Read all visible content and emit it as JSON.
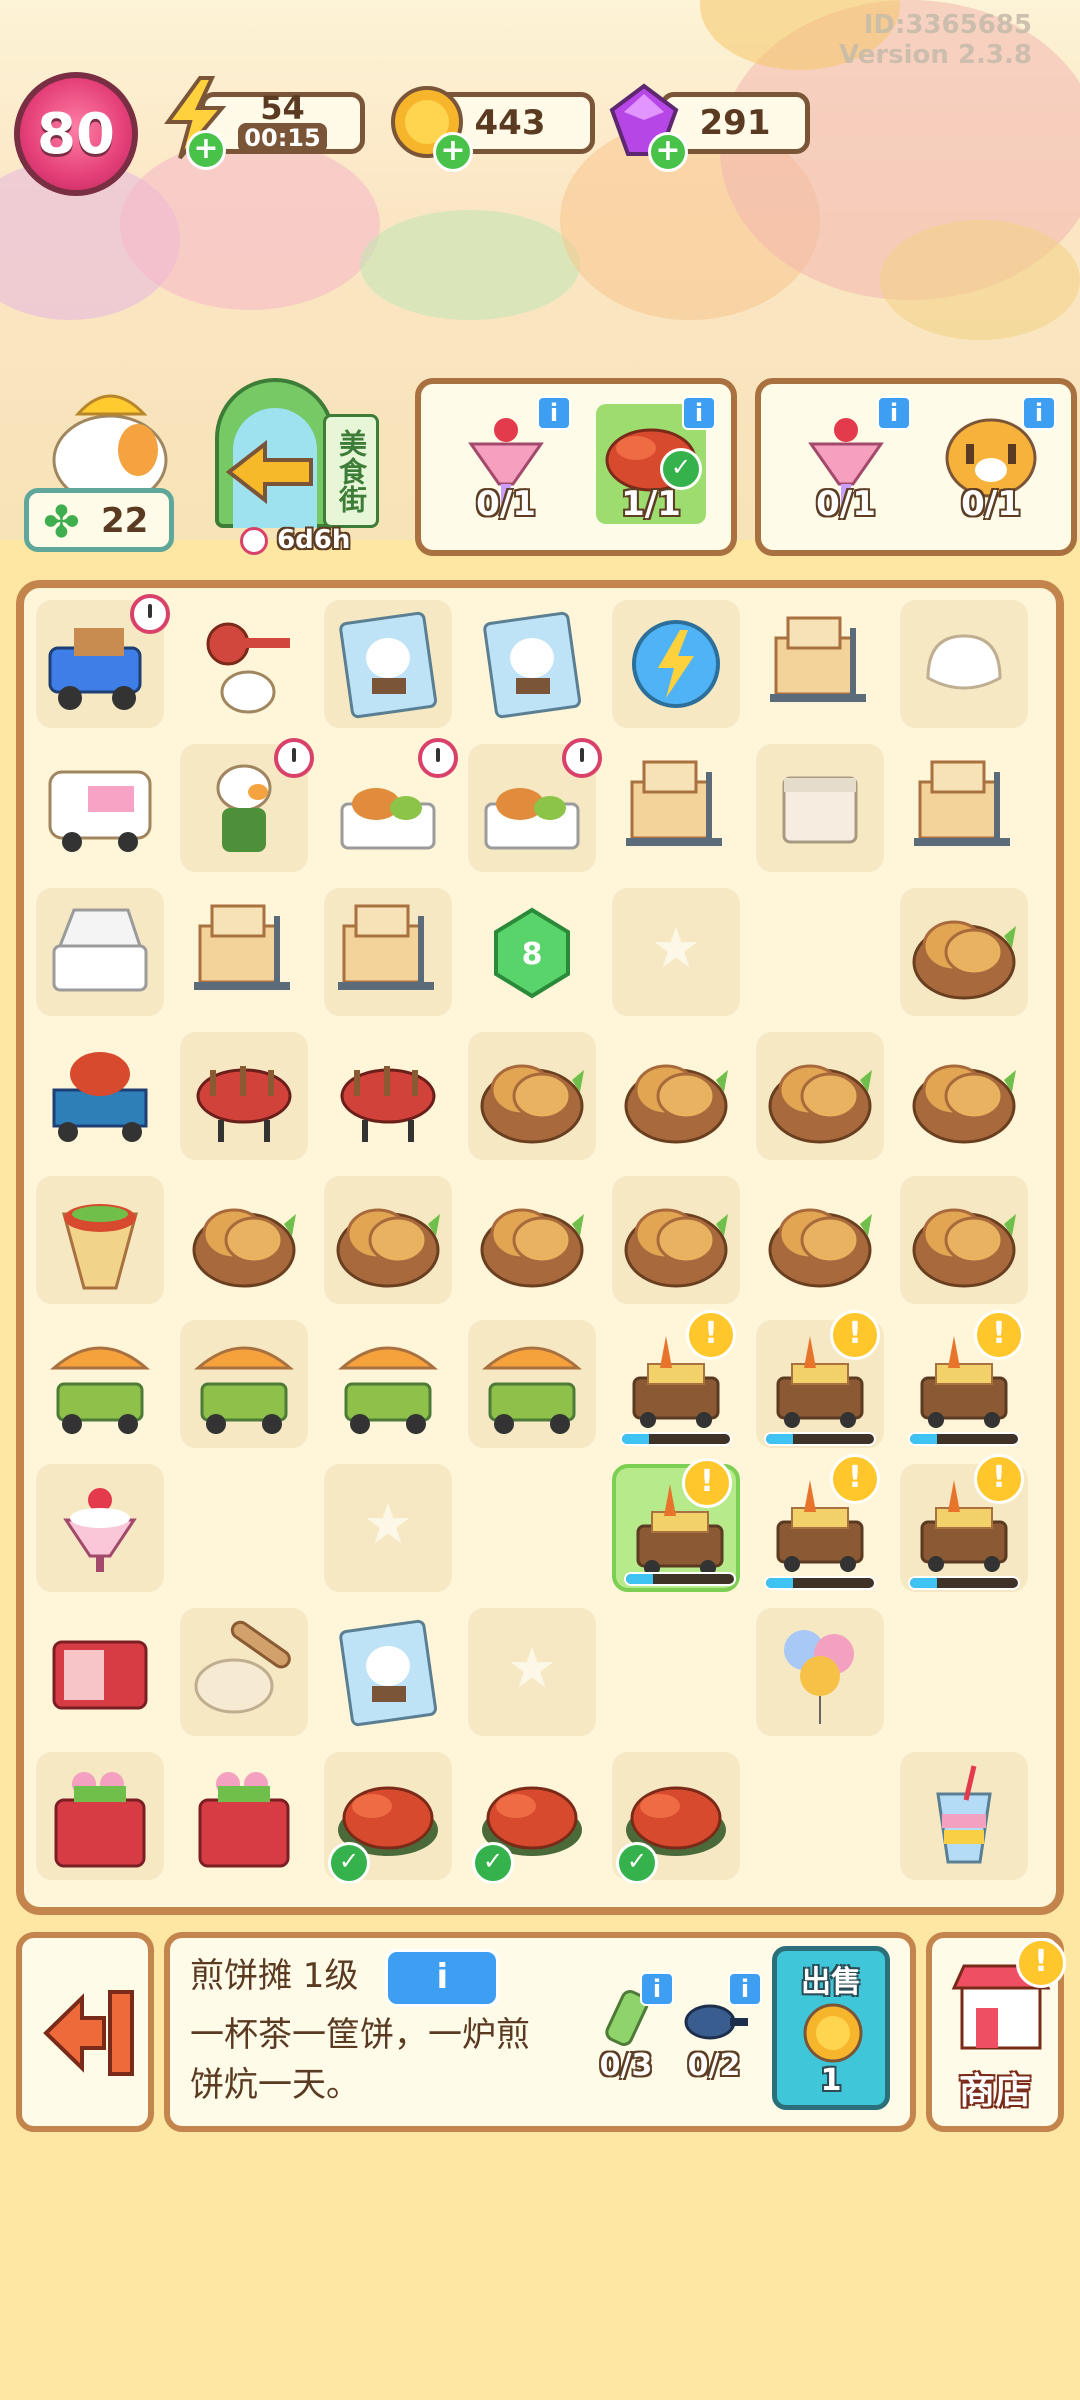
{
  "header": {
    "level": "80",
    "energy": {
      "value": "54",
      "timer": "00:15"
    },
    "coins": "443",
    "gems": "291",
    "player_id": "ID:3365685",
    "version": "Version 2.3.8"
  },
  "left_panel": {
    "clover_count": "22",
    "street_sign": "美食街",
    "street_timer": "6d6h"
  },
  "orders": [
    {
      "items": [
        {
          "name": "parfait",
          "count": "0/1"
        },
        {
          "name": "crayfish",
          "count": "1/1",
          "done": true
        }
      ]
    },
    {
      "items": [
        {
          "name": "parfait",
          "count": "0/1"
        },
        {
          "name": "tiger",
          "count": "0/1"
        }
      ]
    }
  ],
  "info_panel": {
    "title": "煎饼摊 1级",
    "description_line1": "一杯茶一筐饼，一炉煎",
    "description_line2": "饼炕一天。",
    "req1": "0/3",
    "req2": "0/2",
    "sell_label": "出售",
    "sell_price": "1",
    "shop_label": "商店"
  },
  "board": {
    "cols": 7,
    "rows": 9,
    "cells": [
      [
        "delivery-truck",
        "keys",
        "seed-packet",
        "seed-packet",
        "energy-orb",
        "cart-boxes",
        "dough"
      ],
      [
        "food-truck",
        "duck-vendor",
        "lunch-box",
        "lunch-box",
        "cart-boxes",
        "box",
        "cart-boxes"
      ],
      [
        "lunch-box-empty",
        "cart-boxes",
        "cart-boxes",
        "green-gem",
        "star",
        "empty",
        "pancake-basket"
      ],
      [
        "crayfish-cart",
        "bbq-grill",
        "bbq-grill",
        "pancake-basket",
        "pancake-basket",
        "pancake-basket",
        "pancake-basket"
      ],
      [
        "wrap",
        "pancake-basket",
        "pancake-basket",
        "pancake-basket",
        "pancake-basket",
        "pancake-basket",
        "pancake-basket"
      ],
      [
        "umbrella-cart",
        "umbrella-cart",
        "umbrella-cart",
        "umbrella-cart",
        "pancake-stall",
        "pancake-stall",
        "pancake-stall"
      ],
      [
        "sundae",
        "empty",
        "star",
        "empty",
        "pancake-stall-selected",
        "pancake-stall",
        "pancake-stall"
      ],
      [
        "fridge",
        "dough-roll",
        "seed-packet",
        "star",
        "empty",
        "balloons",
        "empty"
      ],
      [
        "flower-fridge",
        "flower-fridge",
        "crayfish-plate",
        "crayfish-plate",
        "crayfish-plate",
        "empty",
        "rainbow-drink"
      ]
    ]
  }
}
